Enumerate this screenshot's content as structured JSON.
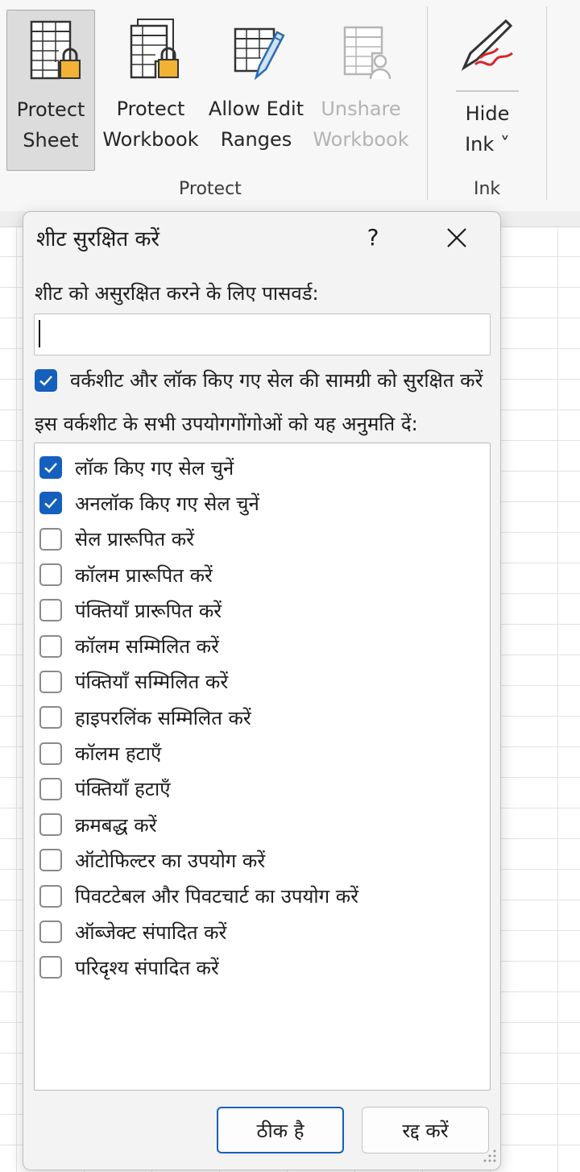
{
  "ribbon": {
    "buttons": {
      "protect_sheet": "Protect\nSheet",
      "protect_workbook": "Protect\nWorkbook",
      "allow_edit_ranges": "Allow Edit\nRanges",
      "unshare_workbook": "Unshare\nWorkbook",
      "hide_ink": "Hide\nInk ˅"
    },
    "groups": {
      "protect": "Protect",
      "ink": "Ink"
    }
  },
  "dialog": {
    "title": "शीट सुरक्षित करें",
    "help": "?",
    "password_label": "शीट को असुरक्षित करने के लिए पासवर्ड:",
    "password_value": "",
    "protect_contents": {
      "label": "वर्कशीट और लॉक किए गए सेल की सामग्री को सुरक्षित करें",
      "checked": true
    },
    "allow_label": "इस वर्कशीट के सभी उपयोगगोंगोओं को यह अनुमति दें:",
    "permissions": [
      {
        "label": "लॉक किए गए सेल चुनें",
        "checked": true
      },
      {
        "label": "अनलॉक किए गए सेल चुनें",
        "checked": true
      },
      {
        "label": "सेल प्रारूपित करें",
        "checked": false
      },
      {
        "label": "कॉलम प्रारूपित करें",
        "checked": false
      },
      {
        "label": "पंक्तियाँ प्रारूपित करें",
        "checked": false
      },
      {
        "label": "कॉलम सम्मिलित करें",
        "checked": false
      },
      {
        "label": "पंक्तियाँ सम्मिलित करें",
        "checked": false
      },
      {
        "label": "हाइपरलिंक सम्मिलित करें",
        "checked": false
      },
      {
        "label": "कॉलम हटाएँ",
        "checked": false
      },
      {
        "label": "पंक्तियाँ हटाएँ",
        "checked": false
      },
      {
        "label": "क्रमबद्ध करें",
        "checked": false
      },
      {
        "label": "ऑटोफिल्टर का उपयोग करें",
        "checked": false
      },
      {
        "label": "पिवटटेबल और पिवटचार्ट का उपयोग करें",
        "checked": false
      },
      {
        "label": "ऑब्जेक्ट संपादित करें",
        "checked": false
      },
      {
        "label": "परिदृश्य संपादित करें",
        "checked": false
      }
    ],
    "ok_label": "ठीक है",
    "cancel_label": "रद्द करें"
  },
  "colors": {
    "accent": "#1560bd",
    "lock": "#f2b233",
    "ink": "#d9262b"
  }
}
